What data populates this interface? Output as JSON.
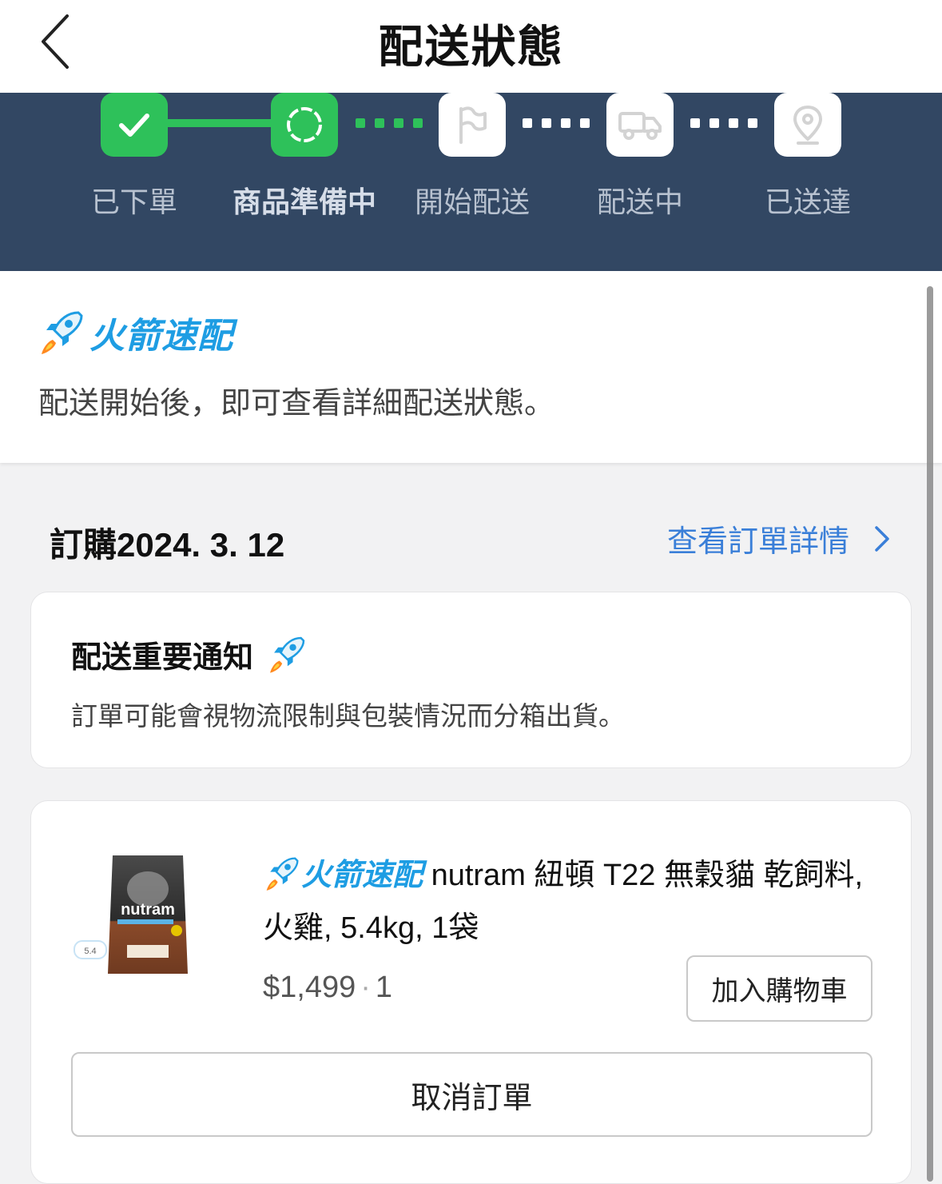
{
  "header": {
    "title": "配送狀態",
    "back_icon": "chevron-left-icon"
  },
  "progress": {
    "steps": [
      {
        "label": "已下單",
        "icon": "check-icon",
        "state": "done"
      },
      {
        "label": "商品準備中",
        "icon": "loading-ring-icon",
        "state": "current"
      },
      {
        "label": "開始配送",
        "icon": "flag-icon",
        "state": "pending"
      },
      {
        "label": "配送中",
        "icon": "truck-icon",
        "state": "pending"
      },
      {
        "label": "已送達",
        "icon": "location-pin-icon",
        "state": "pending"
      }
    ],
    "colors": {
      "band": "#324763",
      "done": "#2ec15a",
      "pending": "#ffffff"
    }
  },
  "rocket_info": {
    "brand": "火箭速配",
    "description": "配送開始後，即可查看詳細配送狀態。"
  },
  "order": {
    "date_label": "訂購2024. 3. 12",
    "detail_link": "查看訂單詳情"
  },
  "notice": {
    "title": "配送重要通知",
    "text": "訂單可能會視物流限制與包裝情況而分箱出貨。"
  },
  "product": {
    "brand": "火箭速配",
    "name": "nutram 紐頓 T22 無穀貓 乾飼料, 火雞, 5.4kg, 1袋",
    "price": "$1,499",
    "separator": "·",
    "quantity": "1",
    "add_to_cart": "加入購物車",
    "cancel_order": "取消訂單",
    "image_text": "nutram"
  },
  "accent_color": "#1e9de3",
  "link_color": "#3a7fd8"
}
